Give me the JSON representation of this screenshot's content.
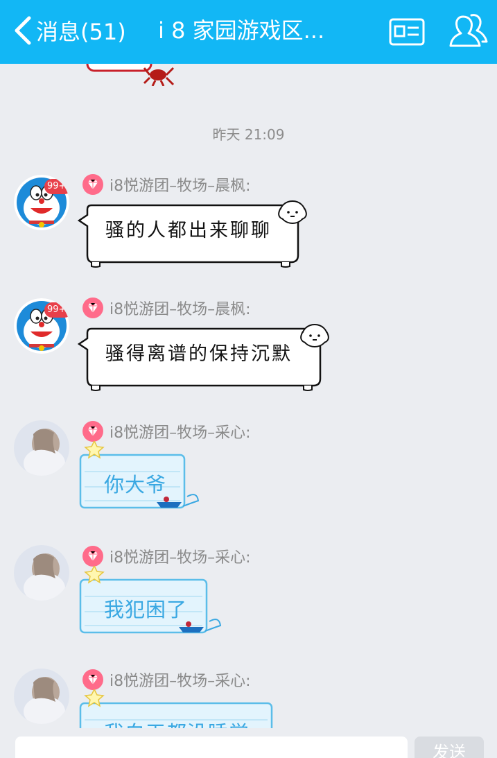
{
  "header": {
    "back_label": "消息(51)",
    "title": "i 8 家园游戏区..."
  },
  "chat": {
    "timestamp": "昨天 21:09",
    "messages": [
      {
        "sender": "i8悦游团–牧场–晨枫:",
        "text": "骚的人都出来聊聊",
        "style": "dog",
        "avatar": "doraemon-avatar"
      },
      {
        "sender": "i8悦游团–牧场–晨枫:",
        "text": "骚得离谱的保持沉默",
        "style": "dog",
        "avatar": "doraemon-avatar"
      },
      {
        "sender": "i8悦游团–牧场–采心:",
        "text": "你大爷",
        "style": "blue",
        "avatar": "girl-avatar"
      },
      {
        "sender": "i8悦游团–牧场–采心:",
        "text": "我犯困了",
        "style": "blue",
        "avatar": "girl-avatar"
      },
      {
        "sender": "i8悦游团–牧场–采心:",
        "text": "我白天都没睡觉",
        "style": "blue",
        "avatar": "girl-avatar"
      }
    ],
    "avatar_badge": "99+"
  },
  "composer": {
    "input_value": "",
    "send_label": "发送"
  },
  "colors": {
    "header_bg": "#12b7f5",
    "chat_bg": "#ebedf1",
    "blue_text": "#3aa8e2",
    "sender_text": "#8a8a8a"
  }
}
